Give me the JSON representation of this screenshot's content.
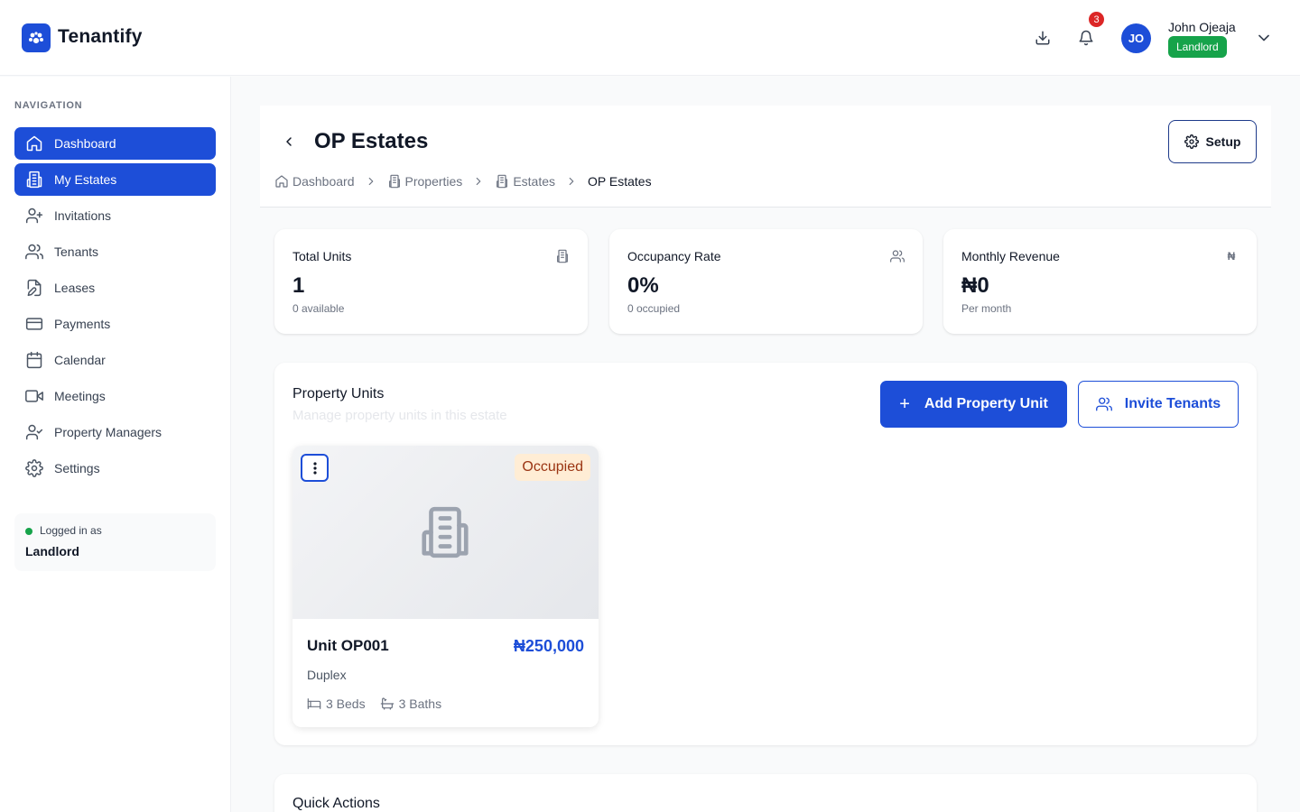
{
  "app": {
    "name": "Tenantify"
  },
  "header": {
    "notifications_count": "3",
    "user": {
      "initials": "JO",
      "name": "John Ojeaja",
      "role": "Landlord"
    }
  },
  "sidebar": {
    "heading": "NAVIGATION",
    "items": [
      {
        "label": "Dashboard",
        "icon": "home-icon"
      },
      {
        "label": "My Estates",
        "icon": "building-icon"
      },
      {
        "label": "Invitations",
        "icon": "user-plus-icon"
      },
      {
        "label": "Tenants",
        "icon": "users-icon"
      },
      {
        "label": "Leases",
        "icon": "file-edit-icon"
      },
      {
        "label": "Payments",
        "icon": "credit-card-icon"
      },
      {
        "label": "Calendar",
        "icon": "calendar-icon"
      },
      {
        "label": "Meetings",
        "icon": "video-icon"
      },
      {
        "label": "Property Managers",
        "icon": "user-check-icon"
      },
      {
        "label": "Settings",
        "icon": "gear-icon"
      }
    ],
    "logged_in": {
      "label": "Logged in as",
      "role": "Landlord"
    }
  },
  "page": {
    "title": "OP Estates",
    "setup_label": "Setup",
    "breadcrumb": [
      "Dashboard",
      "Properties",
      "Estates",
      "OP Estates"
    ]
  },
  "stats": [
    {
      "title": "Total Units",
      "value": "1",
      "sub": "0 available",
      "icon": "building-icon"
    },
    {
      "title": "Occupancy Rate",
      "value": "0%",
      "sub": "0 occupied",
      "icon": "users-icon"
    },
    {
      "title": "Monthly Revenue",
      "value": "₦0",
      "sub": "Per month",
      "icon": "naira-icon",
      "icon_text": "₦"
    }
  ],
  "units": {
    "title": "Property Units",
    "description": "Manage property units in this estate",
    "add_label": "Add Property Unit",
    "invite_label": "Invite Tenants",
    "items": [
      {
        "name": "Unit OP001",
        "price": "₦250,000",
        "status": "Occupied",
        "type": "Duplex",
        "beds": "3 Beds",
        "baths": "3 Baths"
      }
    ]
  },
  "quick_actions": {
    "title": "Quick Actions"
  },
  "colors": {
    "primary": "#1d4ed8",
    "success": "#16a34a",
    "danger": "#dc2626",
    "occupied_bg": "#ffedd5",
    "occupied_text": "#9a3412"
  }
}
